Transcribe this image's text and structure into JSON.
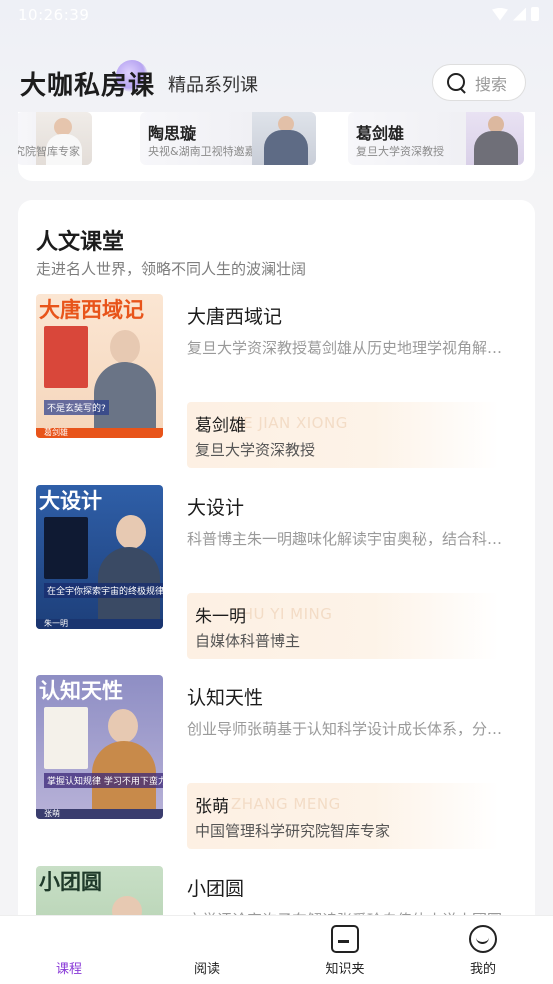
{
  "status_bar": {
    "time": "10:26:39"
  },
  "header": {
    "brand": "大咖私房课",
    "series_tab": "精品系列课",
    "search_placeholder": "搜索"
  },
  "teachers": [
    {
      "name": "",
      "title": "究院智库专家"
    },
    {
      "name": "陶思璇",
      "title": "央视&湖南卫视特邀嘉宾"
    },
    {
      "name": "葛剑雄",
      "title": "复旦大学资深教授"
    }
  ],
  "section": {
    "title": "人文课堂",
    "subtitle": "走进名人世界，领略不同人生的波澜壮阔"
  },
  "courses": [
    {
      "cover_title": "大唐西域记",
      "cover_tag": "不是玄奘写的?",
      "cover_author": "葛剑雄",
      "title": "大唐西域记",
      "desc": "复旦大学资深教授葛剑雄从历史地理学视角解读大唐西域记",
      "lecturer_name": "葛剑雄",
      "lecturer_en": "GE JIAN XIONG",
      "lecturer_title": "复旦大学资深教授"
    },
    {
      "cover_title": "大设计",
      "cover_tag": "在全宇你探索宇宙的终极规律",
      "cover_author": "朱一明",
      "title": "大设计",
      "desc": "科普博主朱一明趣味化解读宇宙奥秘，结合科学史讲述大设计",
      "lecturer_name": "朱一明",
      "lecturer_en": "ZHU YI MING",
      "lecturer_title": "自媒体科普博主"
    },
    {
      "cover_title": "认知天性",
      "cover_tag": "掌握认知规律 学习不用下蛮力",
      "cover_author": "张萌",
      "title": "认知天性",
      "desc": "创业导师张萌基于认知科学设计成长体系，分享高效学习方法",
      "lecturer_name": "张萌",
      "lecturer_en": "ZHANG MENG",
      "lecturer_title": "中国管理科学研究院智库专家"
    },
    {
      "cover_title": "小团圆",
      "cover_tag": "",
      "cover_author": "",
      "title": "小团圆",
      "desc": "文学评论家许子东解读张爱玲自传体小说小团圆",
      "lecturer_name": "",
      "lecturer_en": "",
      "lecturer_title": ""
    }
  ],
  "tabbar": {
    "items": [
      {
        "label": "课程",
        "active": true
      },
      {
        "label": "阅读",
        "active": false
      },
      {
        "label": "知识夹",
        "active": false
      },
      {
        "label": "我的",
        "active": false
      }
    ]
  },
  "colors": {
    "accent": "#8a3bd8",
    "lecturer_bg": "#fdf0e3",
    "page_bg": "#f4f4f6"
  }
}
